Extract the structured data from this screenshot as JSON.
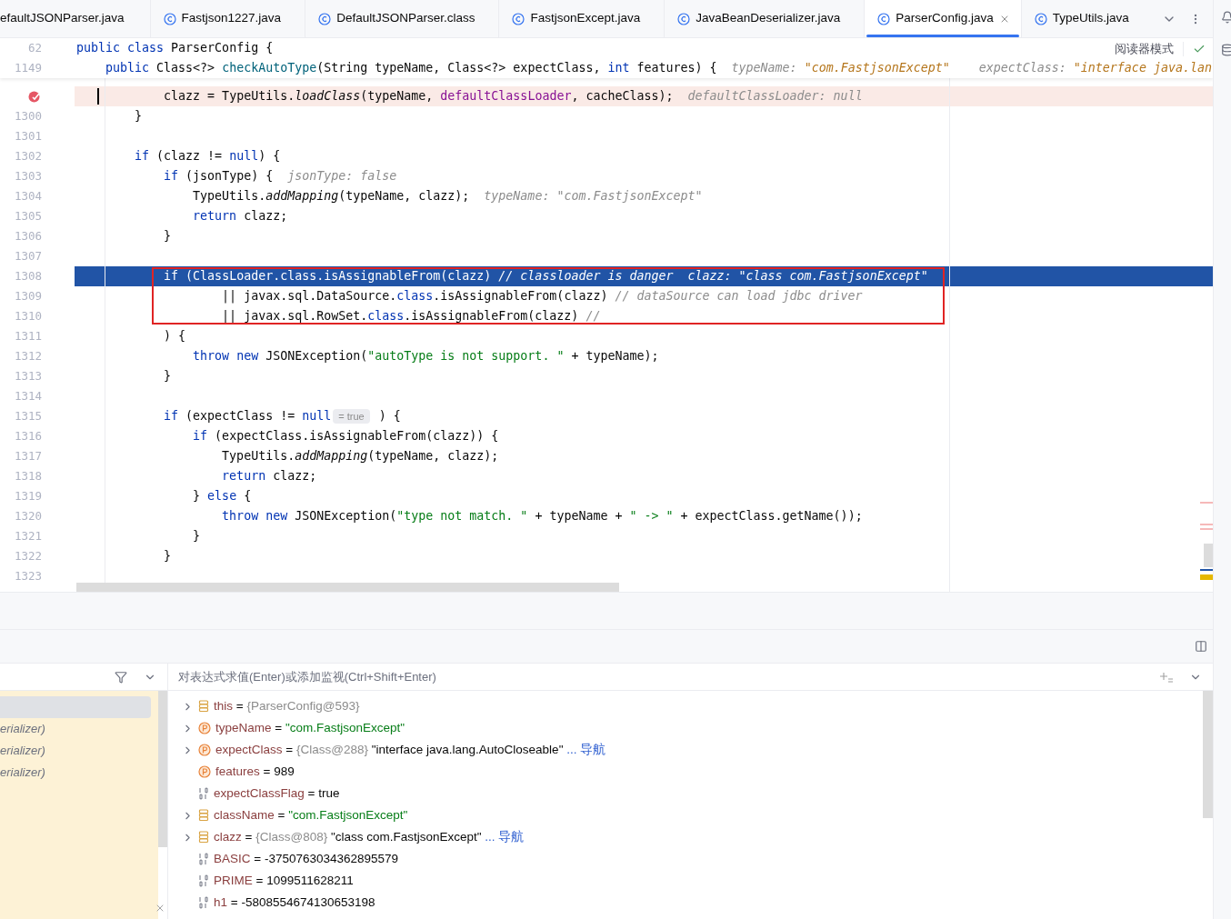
{
  "tabs": [
    {
      "label": "efaultJSONParser.java",
      "kind": "cut",
      "selected": false
    },
    {
      "label": "Fastjson1227.java",
      "kind": "class",
      "selected": false
    },
    {
      "label": "DefaultJSONParser.class",
      "kind": "class",
      "selected": false
    },
    {
      "label": "FastjsonExcept.java",
      "kind": "class",
      "selected": false
    },
    {
      "label": "JavaBeanDeserializer.java",
      "kind": "class",
      "selected": false
    },
    {
      "label": "ParserConfig.java",
      "kind": "class",
      "selected": true
    },
    {
      "label": "TypeUtils.java",
      "kind": "class",
      "selected": false
    }
  ],
  "reader_mode": "阅读器模式",
  "sticky_lines": [
    {
      "number": "62",
      "tokens": [
        {
          "kind": "k",
          "text": "public class"
        },
        {
          "kind": "t",
          "text": " ParserConfig {"
        }
      ]
    },
    {
      "number": "1149",
      "tokens": [
        {
          "kind": "k",
          "text": "    public"
        },
        {
          "kind": "t",
          "text": " Class<?> "
        },
        {
          "kind": "d",
          "text": "checkAutoType"
        },
        {
          "kind": "t",
          "text": "(String typeName, Class<?> expectClass, "
        },
        {
          "kind": "k",
          "text": "int"
        },
        {
          "kind": "t",
          "text": " features) {"
        },
        {
          "kind": "hn",
          "text": "  typeName: "
        },
        {
          "kind": "hv",
          "text": "\"com.FastjsonExcept\""
        },
        {
          "kind": "hn",
          "text": "    expectClass: "
        },
        {
          "kind": "hv",
          "text": "\"interface java.lan"
        }
      ]
    }
  ],
  "lines": [
    {
      "breakpoint": true,
      "current": false,
      "tokens": [
        {
          "kind": "t",
          "text": "            clazz = TypeUtils."
        },
        {
          "kind": "i",
          "text": "loadClass"
        },
        {
          "kind": "t",
          "text": "(typeName, "
        },
        {
          "kind": "f",
          "text": "defaultClassLoader"
        },
        {
          "kind": "t",
          "text": ", cacheClass);"
        },
        {
          "kind": "hn",
          "text": "  defaultClassLoader: null"
        }
      ]
    },
    {
      "number": "1300",
      "breakpoint": false,
      "current": false,
      "tokens": [
        {
          "kind": "t",
          "text": "        }"
        }
      ]
    },
    {
      "number": "1301",
      "breakpoint": false,
      "current": false
    },
    {
      "number": "1302",
      "breakpoint": false,
      "current": false,
      "tokens": [
        {
          "kind": "k",
          "text": "        if"
        },
        {
          "kind": "t",
          "text": " (clazz != "
        },
        {
          "kind": "k",
          "text": "null"
        },
        {
          "kind": "t",
          "text": ") {"
        }
      ]
    },
    {
      "number": "1303",
      "breakpoint": false,
      "current": false,
      "tokens": [
        {
          "kind": "k",
          "text": "            if"
        },
        {
          "kind": "t",
          "text": " (jsonType) {"
        },
        {
          "kind": "hn",
          "text": "  jsonType: false"
        }
      ]
    },
    {
      "number": "1304",
      "breakpoint": false,
      "current": false,
      "tokens": [
        {
          "kind": "t",
          "text": "                TypeUtils."
        },
        {
          "kind": "i",
          "text": "addMapping"
        },
        {
          "kind": "t",
          "text": "(typeName, clazz);"
        },
        {
          "kind": "hn",
          "text": "  typeName: \"com.FastjsonExcept\""
        }
      ]
    },
    {
      "number": "1305",
      "breakpoint": false,
      "current": false,
      "tokens": [
        {
          "kind": "k",
          "text": "                return"
        },
        {
          "kind": "t",
          "text": " clazz;"
        }
      ]
    },
    {
      "number": "1306",
      "breakpoint": false,
      "current": false,
      "tokens": [
        {
          "kind": "t",
          "text": "            }"
        }
      ]
    },
    {
      "number": "1307",
      "breakpoint": false,
      "current": false
    },
    {
      "number": "1308",
      "breakpoint": false,
      "current": true,
      "tokens": [
        {
          "kind": "k",
          "text": "            if"
        },
        {
          "kind": "t",
          "text": " (ClassLoader."
        },
        {
          "kind": "k",
          "text": "class"
        },
        {
          "kind": "t",
          "text": ".isAssignableFrom(clazz) "
        },
        {
          "kind": "c",
          "text": "// classloader is danger"
        },
        {
          "kind": "hn",
          "text": "  clazz: \"class com.FastjsonExcept\""
        }
      ]
    },
    {
      "number": "1309",
      "breakpoint": false,
      "current": false,
      "tokens": [
        {
          "kind": "t",
          "text": "                    || javax.sql.DataSource."
        },
        {
          "kind": "k",
          "text": "class"
        },
        {
          "kind": "t",
          "text": ".isAssignableFrom(clazz) "
        },
        {
          "kind": "c",
          "text": "// dataSource can load jdbc driver"
        }
      ]
    },
    {
      "number": "1310",
      "breakpoint": false,
      "current": false,
      "tokens": [
        {
          "kind": "t",
          "text": "                    || javax.sql.RowSet."
        },
        {
          "kind": "k",
          "text": "class"
        },
        {
          "kind": "t",
          "text": ".isAssignableFrom(clazz) "
        },
        {
          "kind": "c",
          "text": "//"
        }
      ]
    },
    {
      "number": "1311",
      "breakpoint": false,
      "current": false,
      "tokens": [
        {
          "kind": "t",
          "text": "            ) {"
        }
      ]
    },
    {
      "number": "1312",
      "breakpoint": false,
      "current": false,
      "tokens": [
        {
          "kind": "k",
          "text": "                throw new"
        },
        {
          "kind": "t",
          "text": " JSONException("
        },
        {
          "kind": "s",
          "text": "\"autoType is not support. \""
        },
        {
          "kind": "t",
          "text": " + typeName);"
        }
      ]
    },
    {
      "number": "1313",
      "breakpoint": false,
      "current": false,
      "tokens": [
        {
          "kind": "t",
          "text": "            }"
        }
      ]
    },
    {
      "number": "1314",
      "breakpoint": false,
      "current": false
    },
    {
      "number": "1315",
      "breakpoint": false,
      "current": false,
      "tokens": [
        {
          "kind": "k",
          "text": "            if"
        },
        {
          "kind": "t",
          "text": " (expectClass != "
        },
        {
          "kind": "k",
          "text": "null"
        },
        {
          "kind": "b",
          "text": "= true"
        },
        {
          "kind": "t",
          "text": " ) {"
        }
      ]
    },
    {
      "number": "1316",
      "breakpoint": false,
      "current": false,
      "tokens": [
        {
          "kind": "k",
          "text": "                if"
        },
        {
          "kind": "t",
          "text": " (expectClass.isAssignableFrom(clazz)) {"
        }
      ]
    },
    {
      "number": "1317",
      "breakpoint": false,
      "current": false,
      "tokens": [
        {
          "kind": "t",
          "text": "                    TypeUtils."
        },
        {
          "kind": "i",
          "text": "addMapping"
        },
        {
          "kind": "t",
          "text": "(typeName, clazz);"
        }
      ]
    },
    {
      "number": "1318",
      "breakpoint": false,
      "current": false,
      "tokens": [
        {
          "kind": "k",
          "text": "                    return"
        },
        {
          "kind": "t",
          "text": " clazz;"
        }
      ]
    },
    {
      "number": "1319",
      "breakpoint": false,
      "current": false,
      "tokens": [
        {
          "kind": "t",
          "text": "                } "
        },
        {
          "kind": "k",
          "text": "else"
        },
        {
          "kind": "t",
          "text": " {"
        }
      ]
    },
    {
      "number": "1320",
      "breakpoint": false,
      "current": false,
      "tokens": [
        {
          "kind": "k",
          "text": "                    throw new"
        },
        {
          "kind": "t",
          "text": " JSONException("
        },
        {
          "kind": "s",
          "text": "\"type not match. \""
        },
        {
          "kind": "t",
          "text": " + typeName + "
        },
        {
          "kind": "s",
          "text": "\" -> \""
        },
        {
          "kind": "t",
          "text": " + expectClass.getName());"
        }
      ]
    },
    {
      "number": "1321",
      "breakpoint": false,
      "current": false,
      "tokens": [
        {
          "kind": "t",
          "text": "                }"
        }
      ]
    },
    {
      "number": "1322",
      "breakpoint": false,
      "current": false,
      "tokens": [
        {
          "kind": "t",
          "text": "            }"
        }
      ]
    },
    {
      "number": "1323",
      "breakpoint": false,
      "current": false
    }
  ],
  "frames": [
    {
      "selected": true
    },
    {
      "text": "erializer)",
      "selected": false
    },
    {
      "text": "erializer)",
      "selected": false
    },
    {
      "text": "erializer)",
      "selected": false
    }
  ],
  "expression_field": {
    "placeholder": "对表达式求值(Enter)或添加监视(Ctrl+Shift+Enter)"
  },
  "variables": [
    {
      "kind": "object",
      "expandable": true,
      "name": "this",
      "parts": [
        {
          "kind": "op",
          "text": "="
        },
        {
          "kind": "ref",
          "text": "{ParserConfig@593}"
        }
      ]
    },
    {
      "kind": "param",
      "expandable": true,
      "name": "typeName",
      "parts": [
        {
          "kind": "op",
          "text": "="
        },
        {
          "kind": "str",
          "text": "\"com.FastjsonExcept\""
        }
      ]
    },
    {
      "kind": "param",
      "expandable": true,
      "name": "expectClass",
      "parts": [
        {
          "kind": "op",
          "text": "="
        },
        {
          "kind": "ref",
          "text": "{Class@288}"
        },
        {
          "kind": "plain",
          "text": "\"interface java.lang.AutoCloseable\""
        },
        {
          "kind": "link",
          "text": "... 导航"
        }
      ]
    },
    {
      "kind": "param",
      "expandable": false,
      "name": "features",
      "parts": [
        {
          "kind": "op",
          "text": "="
        },
        {
          "kind": "plain",
          "text": "989"
        }
      ]
    },
    {
      "kind": "primitive",
      "expandable": false,
      "name": "expectClassFlag",
      "parts": [
        {
          "kind": "op",
          "text": "="
        },
        {
          "kind": "plain",
          "text": "true"
        }
      ]
    },
    {
      "kind": "object",
      "expandable": true,
      "name": "className",
      "parts": [
        {
          "kind": "op",
          "text": "="
        },
        {
          "kind": "str",
          "text": "\"com.FastjsonExcept\""
        }
      ]
    },
    {
      "kind": "object",
      "expandable": true,
      "name": "clazz",
      "parts": [
        {
          "kind": "op",
          "text": "="
        },
        {
          "kind": "ref",
          "text": "{Class@808}"
        },
        {
          "kind": "plain",
          "text": "\"class com.FastjsonExcept\""
        },
        {
          "kind": "link",
          "text": "... 导航"
        }
      ]
    },
    {
      "kind": "primitive",
      "expandable": false,
      "name": "BASIC",
      "parts": [
        {
          "kind": "op",
          "text": "="
        },
        {
          "kind": "plain",
          "text": "-3750763034362895579"
        }
      ]
    },
    {
      "kind": "primitive",
      "expandable": false,
      "name": "PRIME",
      "parts": [
        {
          "kind": "op",
          "text": "="
        },
        {
          "kind": "plain",
          "text": "1099511628211"
        }
      ]
    },
    {
      "kind": "primitive",
      "expandable": false,
      "name": "h1",
      "parts": [
        {
          "kind": "op",
          "text": "="
        },
        {
          "kind": "plain",
          "text": "-5808554674130653198"
        }
      ]
    }
  ]
}
